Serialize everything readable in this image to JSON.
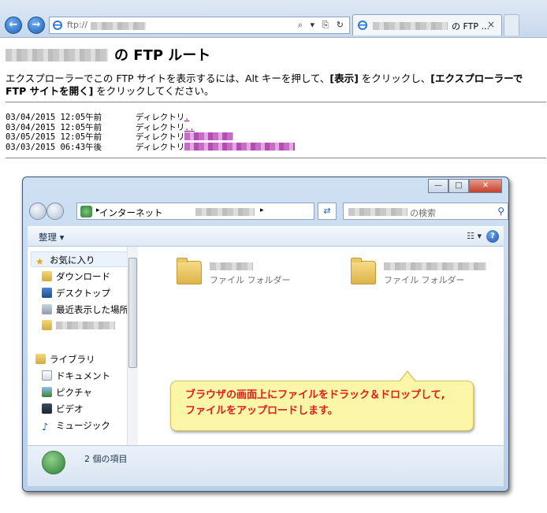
{
  "browser": {
    "address_prefix": "ftp://",
    "address_icons": "⌕ ▾ ⎘ ↻",
    "tab_label": "の FTP ...",
    "tab_close": "×"
  },
  "page": {
    "title_suffix": "の FTP ルート",
    "intro_part1": "エクスプローラーでこの FTP サイトを表示するには、Alt キーを押して、",
    "intro_bold1": "[表示]",
    "intro_part2": " をクリックし、",
    "intro_bold2": "[エクスプローラーで FTP サイトを開く]",
    "intro_part3": " をクリックしてください。",
    "listing": [
      {
        "date": "03/04/2015 12:05午前",
        "type": "ディレクトリ",
        "link": "."
      },
      {
        "date": "03/04/2015 12:05午前",
        "type": "ディレクトリ",
        "link": ".."
      },
      {
        "date": "03/05/2015 12:05午前",
        "type": "ディレクトリ",
        "link": ""
      },
      {
        "date": "03/03/2015 06:43午後",
        "type": "ディレクトリ",
        "link": ""
      }
    ]
  },
  "explorer": {
    "breadcrumb_root": "インターネット",
    "search_suffix": "の検索",
    "organize_label": "整理 ▾",
    "view_label": "☷ ▾",
    "help_label": "?",
    "nav": {
      "favorites": "お気に入り",
      "downloads": "ダウンロード",
      "desktop": "デスクトップ",
      "recent": "最近表示した場所",
      "libraries": "ライブラリ",
      "documents": "ドキュメント",
      "pictures": "ピクチャ",
      "videos": "ビデオ",
      "music": "ミュージック"
    },
    "folder_type": "ファイル フォルダー",
    "status_text": "2 個の項目",
    "callout_line1": "ブラウザの画面上にファイルをドラック＆ドロップして,",
    "callout_line2": "ファイルをアップロードします。"
  },
  "colors": {
    "callout_text": "#e31b1b",
    "callout_bg": "#fcf6a8",
    "link": "#7a007a"
  }
}
